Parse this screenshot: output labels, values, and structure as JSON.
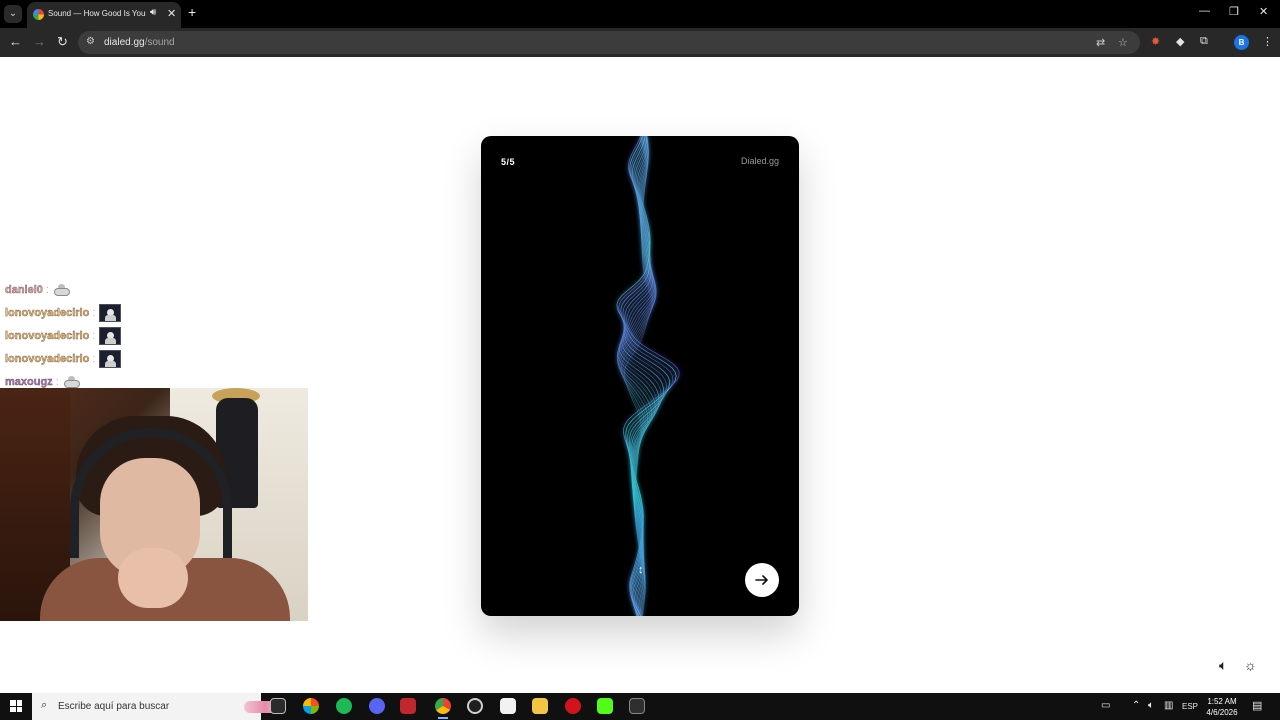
{
  "browser": {
    "tab_title": "Sound — How Good Is Your",
    "url_host": "dialed.gg",
    "url_path": "/sound",
    "profile_initial": "B"
  },
  "card": {
    "counter": "5/5",
    "brand": "Dialed.gg"
  },
  "chat": [
    {
      "user": "daniel0",
      "color": "#d7a3c5",
      "emote": "small"
    },
    {
      "user": "lonovoyadecirlo",
      "color": "#e2b77a",
      "emote": "box"
    },
    {
      "user": "lonovoyadecirlo",
      "color": "#e2b77a",
      "emote": "box"
    },
    {
      "user": "lonovoyadecirlo",
      "color": "#e2b77a",
      "emote": "box"
    },
    {
      "user": "maxougz",
      "color": "#9b6fd6",
      "emote": "small"
    }
  ],
  "taskbar": {
    "search_placeholder": "Escribe aquí para buscar",
    "language": "ESP",
    "time": "1:52 AM",
    "date": "4/6/2026"
  },
  "colors": {
    "wave_teal": "#2ee6b8",
    "wave_purple": "#7b3ff2",
    "wave_blue": "#3a8dff"
  },
  "icons": {
    "next": "arrow-right-icon",
    "volume": "speaker-icon",
    "theme": "sun-icon"
  }
}
